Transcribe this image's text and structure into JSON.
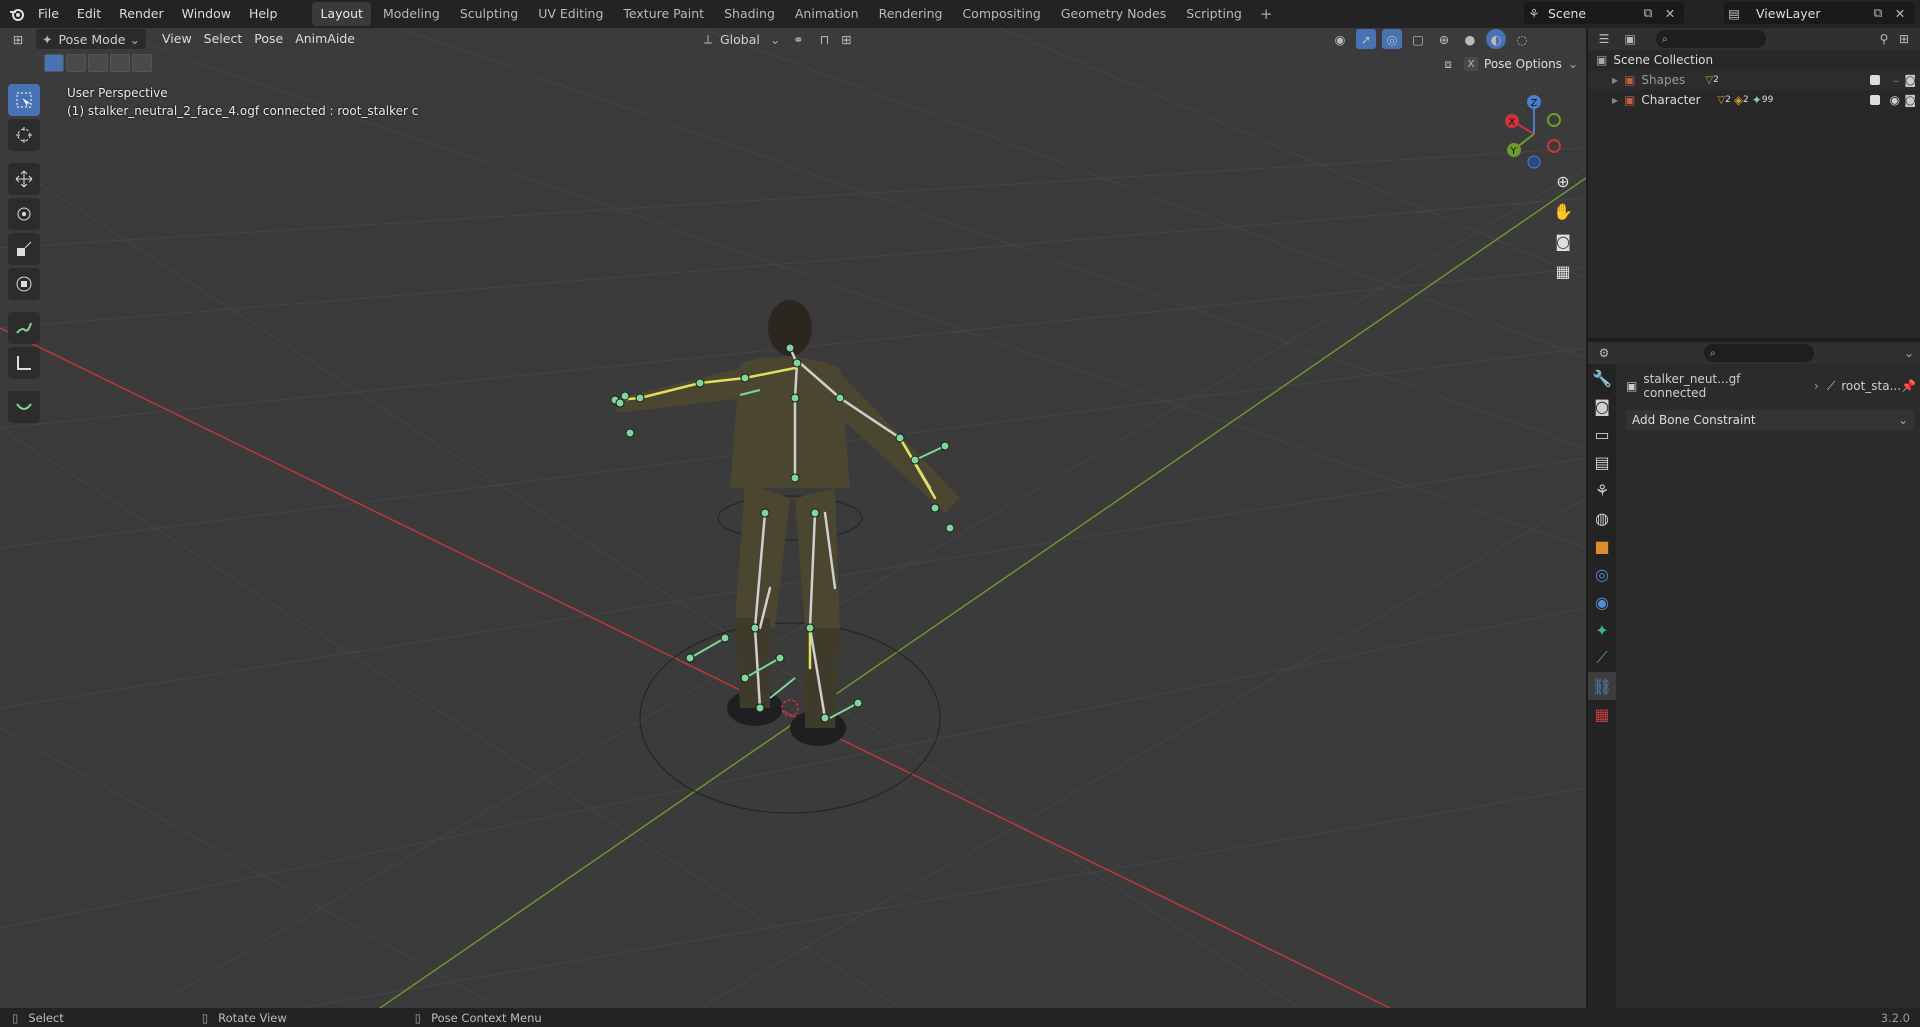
{
  "menubar": {
    "items": [
      "File",
      "Edit",
      "Render",
      "Window",
      "Help"
    ],
    "workspaces": [
      "Layout",
      "Modeling",
      "Sculpting",
      "UV Editing",
      "Texture Paint",
      "Shading",
      "Animation",
      "Rendering",
      "Compositing",
      "Geometry Nodes",
      "Scripting"
    ],
    "active_workspace": "Layout",
    "scene_name": "Scene",
    "view_layer": "ViewLayer"
  },
  "viewport": {
    "mode": "Pose Mode",
    "menus": [
      "View",
      "Select",
      "Pose",
      "AnimAide"
    ],
    "orientation": "Global",
    "perspective_label": "User Perspective",
    "object_label": "(1) stalker_neutral_2_face_4.ogf connected : root_stalker c",
    "pose_options": "Pose Options",
    "axes": {
      "x": "X",
      "y": "Y",
      "z": "Z"
    }
  },
  "outliner": {
    "collection": "Scene Collection",
    "items": [
      {
        "name": "Shapes",
        "badge": "2"
      },
      {
        "name": "Character",
        "badge": "2",
        "badge2": "2",
        "extra": "99"
      }
    ]
  },
  "properties": {
    "breadcrumb_object": "stalker_neut...gf connected",
    "breadcrumb_bone": "root_sta...",
    "add_constraint": "Add Bone Constraint"
  },
  "statusbar": {
    "select": "Select",
    "rotate": "Rotate View",
    "context": "Pose Context Menu",
    "version": "3.2.0"
  },
  "colors": {
    "accent": "#4772b3",
    "x_axis": "#c8363a",
    "y_axis": "#6d9c2a",
    "bone_selected": "#e0e060",
    "bone": "#cfcfcf",
    "joint": "#7fd69a"
  }
}
